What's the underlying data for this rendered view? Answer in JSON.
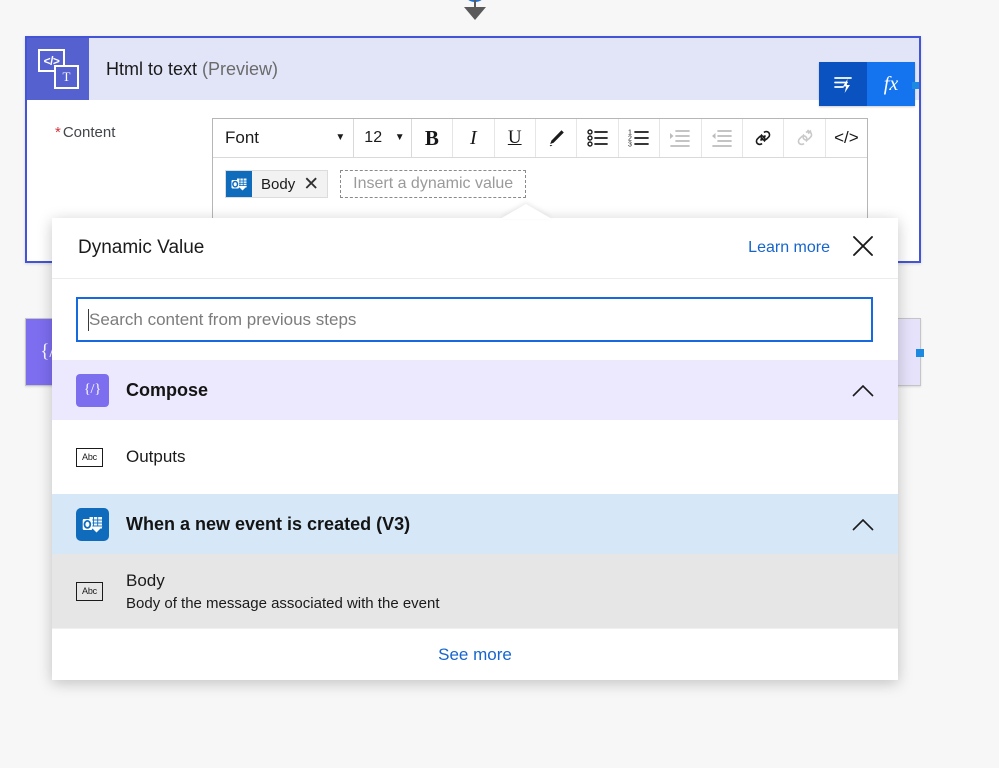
{
  "card": {
    "icon_code": "</>",
    "icon_text": "T",
    "title": "Html to text",
    "title_suffix": "(Preview)",
    "label": "Content",
    "required_mark": "*",
    "header_buttons": [
      {
        "name": "dynamic-content-button",
        "glyph": "⚡"
      },
      {
        "name": "expression-fx-button",
        "label": "fx"
      }
    ]
  },
  "toolbar": {
    "font_name": "Font",
    "font_size": "12",
    "caret": "▼",
    "bold": "B",
    "italic": "I",
    "underline": "U",
    "highlight": "✎",
    "bullet_list": "•≡",
    "numbered_list": "1≡",
    "indent": "→≡",
    "outdent": "←≡",
    "link": "🔗",
    "unlink": "⛓",
    "code_view": "</>"
  },
  "editor": {
    "token_label": "Body",
    "token_close": "✕",
    "placeholder": "Insert a dynamic value"
  },
  "compose_card": {
    "icon": "{/}"
  },
  "dialog": {
    "title": "Dynamic Value",
    "learn_more": "Learn more",
    "close": "✕",
    "search_placeholder": "Search content from previous steps",
    "search_value": "",
    "groups": [
      {
        "name": "compose",
        "label": "Compose",
        "icon": "{/}",
        "expanded": true,
        "items": [
          {
            "title": "Outputs",
            "desc": "",
            "icon": "Abc",
            "hovered": false
          }
        ]
      },
      {
        "name": "when-a-new-event-is-created-v3",
        "label": "When a new event is created (V3)",
        "icon": "outlook",
        "expanded": true,
        "items": [
          {
            "title": "Body",
            "desc": "Body of the message associated with the event",
            "icon": "Abc",
            "hovered": true
          }
        ]
      }
    ],
    "see_more": "See more"
  },
  "colors": {
    "accent_blue": "#1765cc",
    "card_border": "#4354d6",
    "compose_purple": "#7d6ef0",
    "event_blue": "#0f6cbd",
    "required_red": "#d1343f"
  }
}
